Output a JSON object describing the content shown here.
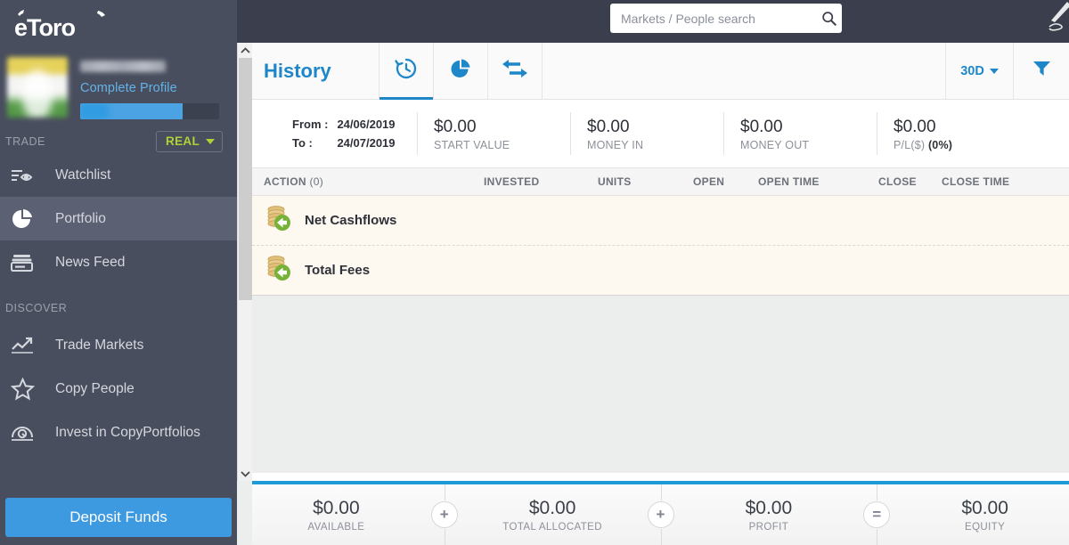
{
  "header": {
    "search": {
      "placeholder": "Markets / People search",
      "value": "",
      "icon": "search-icon"
    },
    "corner_icon": "pen-icon"
  },
  "sidebar": {
    "logo_text": "eToro",
    "profile": {
      "username": "",
      "complete_profile_label": "Complete Profile",
      "progress_percent": 74
    },
    "trade": {
      "section_label": "TRADE",
      "account_mode": "REAL",
      "account_mode_color": "#aed136"
    },
    "items": [
      {
        "label": "Watchlist",
        "icon": "watchlist-eye-icon",
        "active": false
      },
      {
        "label": "Portfolio",
        "icon": "pie-chart-icon",
        "active": true
      },
      {
        "label": "News Feed",
        "icon": "news-feed-icon",
        "active": false
      }
    ],
    "discover_label": "DISCOVER",
    "discover_items": [
      {
        "label": "Trade Markets",
        "icon": "trending-up-icon"
      },
      {
        "label": "Copy People",
        "icon": "star-icon"
      },
      {
        "label": "Invest in CopyPortfolios",
        "icon": "copyportfolio-icon"
      }
    ],
    "deposit_button": "Deposit Funds"
  },
  "panel": {
    "title": "History",
    "tabs": [
      {
        "name": "history",
        "icon": "history-clock-icon",
        "active": true
      },
      {
        "name": "portfolio",
        "icon": "pie-chart-icon",
        "active": false
      },
      {
        "name": "transactions",
        "icon": "exchange-arrows-icon",
        "active": false
      }
    ],
    "range": {
      "label": "30D",
      "icon": "chevron-down-icon"
    },
    "filter_icon": "funnel-icon",
    "date_range": {
      "from_label": "From :",
      "from_value": "24/06/2019",
      "to_label": "To :",
      "to_value": "24/07/2019"
    },
    "stats": [
      {
        "value": "$0.00",
        "label": "START VALUE"
      },
      {
        "value": "$0.00",
        "label": "MONEY IN"
      },
      {
        "value": "$0.00",
        "label": "MONEY OUT"
      },
      {
        "value": "$0.00",
        "label": "P/L($)",
        "sub": "(0%)"
      }
    ],
    "table": {
      "columns": [
        {
          "label": "ACTION",
          "count": "(0)"
        },
        {
          "label": "INVESTED"
        },
        {
          "label": "UNITS"
        },
        {
          "label": "OPEN"
        },
        {
          "label": "OPEN TIME"
        },
        {
          "label": "CLOSE"
        },
        {
          "label": "CLOSE TIME"
        }
      ],
      "rows": [
        {
          "label": "Net Cashflows",
          "icon": "coins-in-icon"
        },
        {
          "label": "Total Fees",
          "icon": "coins-in-icon"
        }
      ]
    }
  },
  "footer": {
    "cells": [
      {
        "value": "$0.00",
        "label": "AVAILABLE"
      },
      {
        "value": "$0.00",
        "label": "TOTAL ALLOCATED"
      },
      {
        "value": "$0.00",
        "label": "PROFIT"
      },
      {
        "value": "$0.00",
        "label": "EQUITY"
      }
    ],
    "operators": [
      "+",
      "+",
      "="
    ]
  },
  "colors": {
    "brand_blue": "#1e87c9",
    "sidebar_bg": "#494e5e",
    "topbar_bg": "#3b3f4d",
    "accent_green": "#aed136",
    "row_bg": "#fdf9f1"
  }
}
